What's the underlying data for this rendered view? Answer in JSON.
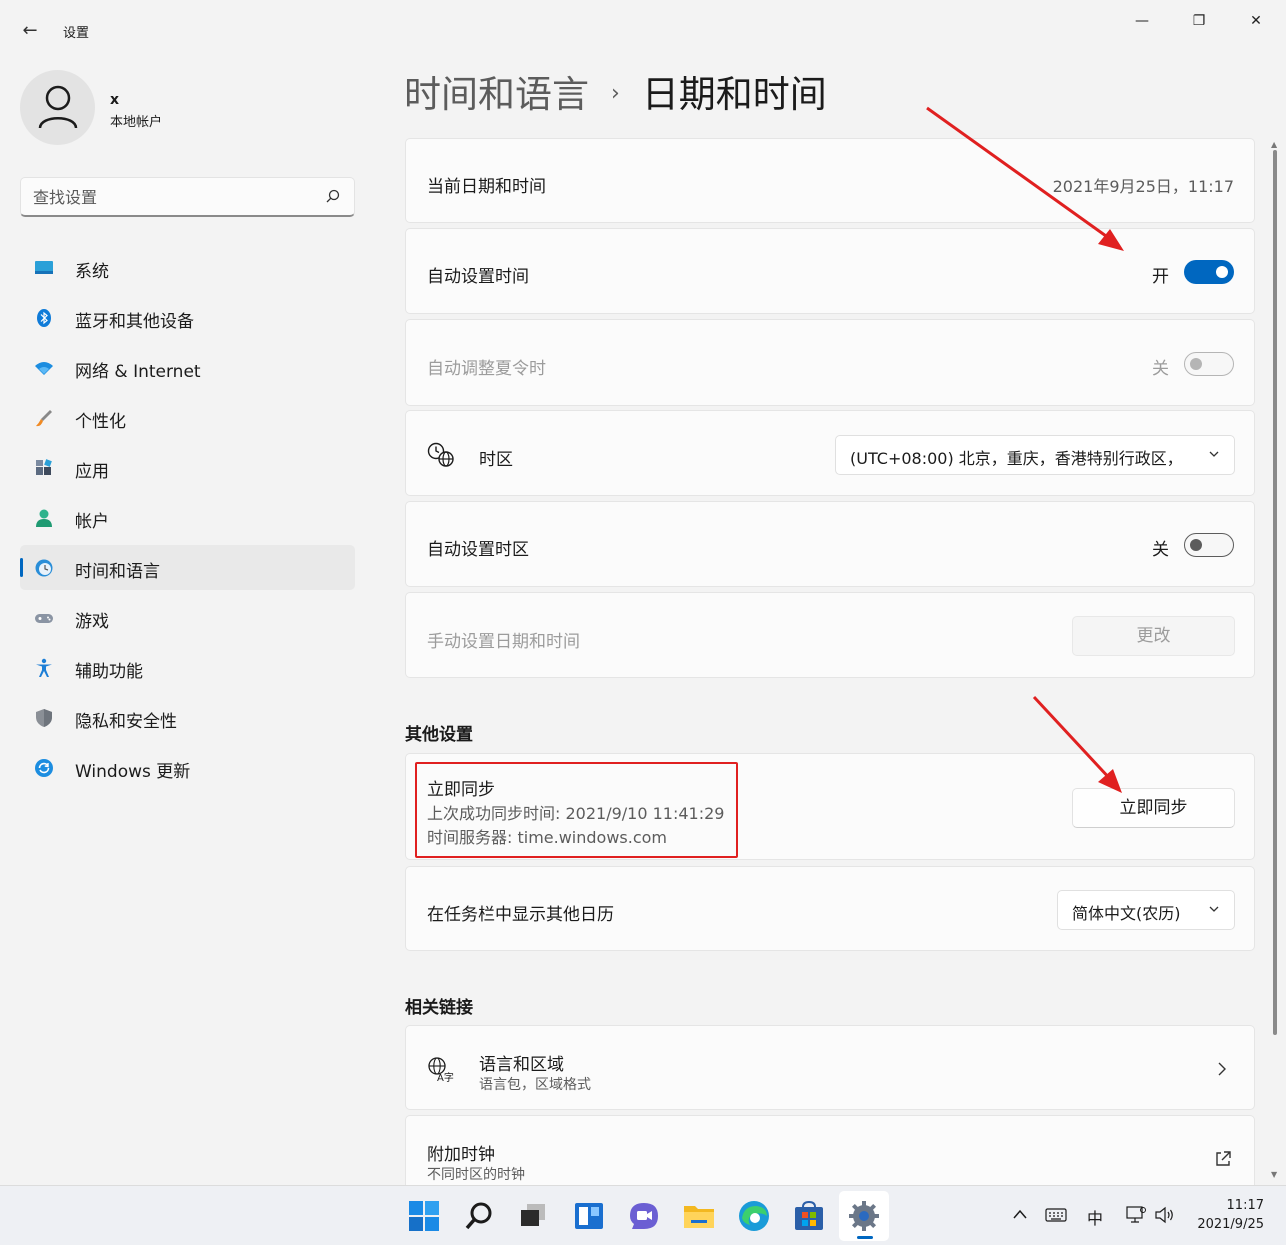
{
  "window": {
    "app_title": "设置",
    "back_glyph": "←",
    "minimize_glyph": "—",
    "maximize_glyph": "❐",
    "close_glyph": "✕"
  },
  "user": {
    "name": "x",
    "account_type": "本地帐户"
  },
  "search": {
    "placeholder": "查找设置"
  },
  "sidebar": {
    "items": [
      {
        "label": "系统",
        "icon": "monitor-icon"
      },
      {
        "label": "蓝牙和其他设备",
        "icon": "bluetooth-icon"
      },
      {
        "label": "网络 & Internet",
        "icon": "wifi-icon"
      },
      {
        "label": "个性化",
        "icon": "brush-icon"
      },
      {
        "label": "应用",
        "icon": "apps-icon"
      },
      {
        "label": "帐户",
        "icon": "person-icon"
      },
      {
        "label": "时间和语言",
        "icon": "globe-clock-icon",
        "active": true
      },
      {
        "label": "游戏",
        "icon": "gamepad-icon"
      },
      {
        "label": "辅助功能",
        "icon": "accessibility-icon"
      },
      {
        "label": "隐私和安全性",
        "icon": "shield-icon"
      },
      {
        "label": "Windows 更新",
        "icon": "update-icon"
      }
    ]
  },
  "breadcrumb": {
    "parent": "时间和语言",
    "separator": "›",
    "current": "日期和时间"
  },
  "settings": {
    "current_datetime": {
      "label": "当前日期和时间",
      "value": "2021年9月25日，11:17"
    },
    "auto_time": {
      "label": "自动设置时间",
      "state_label": "开",
      "on": true
    },
    "auto_dst": {
      "label": "自动调整夏令时",
      "state_label": "关",
      "on": false,
      "disabled": true
    },
    "timezone": {
      "label": "时区",
      "value": "(UTC+08:00) 北京，重庆，香港特别行政区，"
    },
    "auto_timezone": {
      "label": "自动设置时区",
      "state_label": "关",
      "on": false
    },
    "manual_datetime": {
      "label": "手动设置日期和时间",
      "button": "更改",
      "disabled": true
    }
  },
  "other_settings": {
    "title": "其他设置",
    "sync": {
      "title": "立即同步",
      "last_sync": "上次成功同步时间: 2021/9/10 11:41:29",
      "server": "时间服务器: time.windows.com",
      "button": "立即同步"
    },
    "calendar": {
      "label": "在任务栏中显示其他日历",
      "value": "简体中文(农历)"
    }
  },
  "related_links": {
    "title": "相关链接",
    "language_region": {
      "title": "语言和区域",
      "subtitle": "语言包，区域格式"
    },
    "additional_clocks": {
      "title": "附加时钟",
      "subtitle": "不同时区的时钟"
    }
  },
  "taskbar": {
    "ime": "中",
    "time": "11:17",
    "date": "2021/9/25"
  },
  "colors": {
    "accent": "#0067c0",
    "annotation_red": "#e02020"
  }
}
